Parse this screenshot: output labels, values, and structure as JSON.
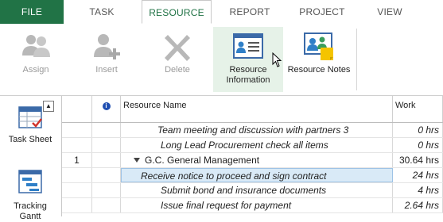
{
  "ribbon_tabs": [
    "FILE",
    "TASK",
    "RESOURCE",
    "REPORT",
    "PROJECT",
    "VIEW"
  ],
  "active_tab": "RESOURCE",
  "buttons": {
    "assign": "Assign",
    "insert": "Insert",
    "delete": "Delete",
    "resource_information": "Resource\nInformation",
    "resource_notes": "Resource Notes"
  },
  "viewbar": {
    "task_sheet": "Task Sheet",
    "tracking_gantt": "Tracking\nGantt"
  },
  "grid": {
    "columns": {
      "name": "Resource Name",
      "work": "Work"
    },
    "rows": [
      {
        "id": "",
        "name": "Team meeting and discussion with partners 3",
        "work": "0 hrs"
      },
      {
        "id": "",
        "name": "Long Lead Procurement check all items",
        "work": "0 hrs"
      },
      {
        "id": "1",
        "name": "G.C. General Management",
        "work": "30.64 hrs"
      },
      {
        "id": "",
        "name": "Receive notice to proceed and sign contract",
        "work": "24 hrs"
      },
      {
        "id": "",
        "name": "Submit bond and insurance documents",
        "work": "4 hrs"
      },
      {
        "id": "",
        "name": "Issue final request for payment",
        "work": "2.64 hrs"
      }
    ]
  },
  "colors": {
    "file_tab": "#217346",
    "accent": "#217346",
    "selection": "#d9eaf7"
  }
}
